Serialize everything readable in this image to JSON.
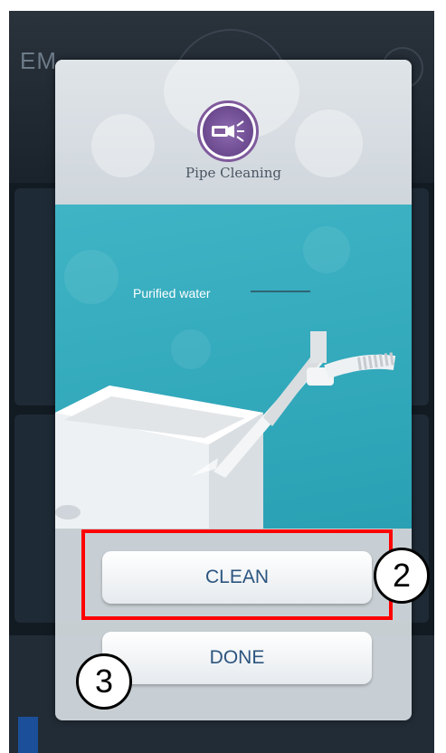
{
  "dialog": {
    "title": "Pipe Cleaning",
    "icon": "pipe-cleaning-icon",
    "illustration": {
      "callout": "Purified water"
    }
  },
  "buttons": {
    "clean_label": "CLEAN",
    "done_label": "DONE"
  },
  "annotations": {
    "marker_clean": "2",
    "marker_done": "3",
    "highlight_color": "#ff0000"
  },
  "colors": {
    "button_text": "#2b557f",
    "accent_purple": "#7f5a9c",
    "illustration_bg": "#3eb4c5"
  }
}
